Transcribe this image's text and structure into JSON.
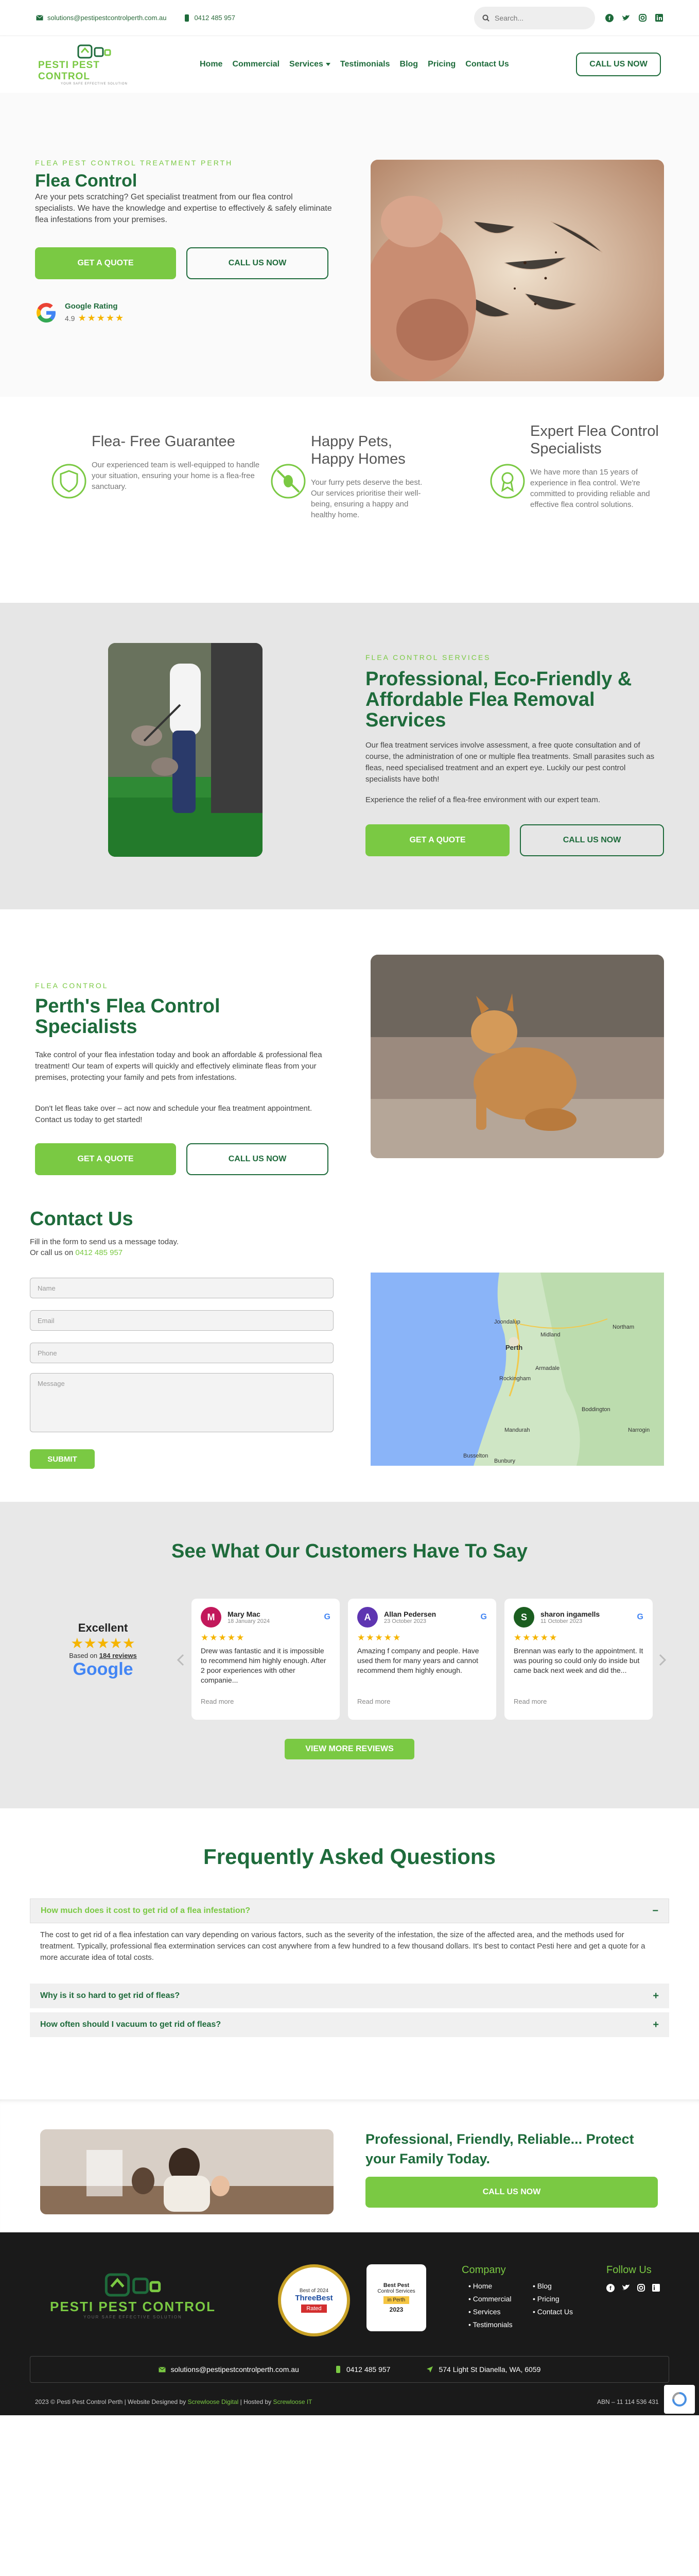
{
  "topbar": {
    "email": "solutions@pestipestcontrolperth.com.au",
    "phone": "0412 485 957",
    "search_placeholder": "Search..."
  },
  "header": {
    "logo_name": "PESTI PEST CONTROL",
    "logo_tag": "YOUR SAFE EFFECTIVE SOLUTION",
    "nav": [
      {
        "label": "Home"
      },
      {
        "label": "Commercial"
      },
      {
        "label": "Services"
      },
      {
        "label": "Testimonials"
      },
      {
        "label": "Blog"
      },
      {
        "label": "Pricing"
      },
      {
        "label": "Contact Us"
      }
    ],
    "cta": "CALL US NOW"
  },
  "hero": {
    "eyebrow": "FLEA PEST CONTROL TREATMENT PERTH",
    "title": "Flea Control",
    "text": "Are your pets scratching? Get specialist treatment from our flea control specialists.  We have the knowledge and expertise to effectively & safely eliminate flea infestations from your premises.",
    "btn_quote": "GET A QUOTE",
    "btn_call": "CALL US NOW",
    "rating_label": "Google Rating",
    "rating_value": "4.9",
    "rating_stars": "★★★★★"
  },
  "features": [
    {
      "title": "Flea- Free Guarantee",
      "text": "Our experienced team is well-equipped to handle your situation, ensuring your home is a flea-free sanctuary."
    },
    {
      "title": "Happy Pets, Happy Homes",
      "text": "Your furry pets deserve the best. Our services prioritise their well-being, ensuring a happy and healthy home."
    },
    {
      "title": "Expert Flea Control Specialists",
      "text": "We have more than 15 years of experience in flea control. We're committed to providing reliable and effective flea control solutions."
    }
  ],
  "services": {
    "eyebrow": "FLEA CONTROL SERVICES",
    "title": "Professional, Eco-Friendly & Affordable Flea Removal Services",
    "p1": "Our flea treatment services involve assessment, a free quote consultation and of course, the administration of one or multiple flea treatments. Small parasites such as fleas, need specialised treatment and an expert eye. Luckily our pest control specialists have both!",
    "p2": "Experience the relief of a flea-free environment with our expert team.",
    "btn_quote": "GET A QUOTE",
    "btn_call": "CALL US NOW"
  },
  "perth": {
    "eyebrow": "FLEA CONTROL",
    "title": "Perth's Flea Control Specialists",
    "p1": "Take control of your flea infestation today and book an affordable & professional flea treatment! Our team of experts will quickly and effectively eliminate fleas from your premises, protecting your family and pets from infestations.",
    "p2": "Don't let fleas take over – act now and schedule your flea treatment appointment. Contact us today to get started!",
    "btn_quote": "GET A QUOTE",
    "btn_call": "CALL US NOW"
  },
  "contact": {
    "title": "Contact Us",
    "sub": "Fill in the form to send us a message today.",
    "call_prefix": "Or call us on",
    "phone": "0412 485 957",
    "name_ph": "Name",
    "email_ph": "Email",
    "phone_ph": "Phone",
    "message_ph": "Message",
    "submit": "SUBMIT",
    "map_labels": [
      "Perth",
      "Mandurah",
      "Joondalup",
      "Rockingham",
      "Bunbury",
      "Busselton",
      "Armadale",
      "Midland",
      "Northam",
      "Boddington",
      "Narrogin"
    ]
  },
  "reviews": {
    "title": "See What Our Customers Have To Say",
    "summary_label": "Excellent",
    "summary_stars": "★★★★★",
    "based_prefix": "Based on",
    "based_count": "184 reviews",
    "google": "Google",
    "cards": [
      {
        "initial": "M",
        "name": "Mary Mac",
        "date": "18 January 2024",
        "stars": "★★★★★",
        "text": "Drew was fantastic and it is impossible to recommend him highly enough. After 2 poor experiences with other companie...",
        "more": "Read more"
      },
      {
        "initial": "A",
        "name": "Allan Pedersen",
        "date": "23 October 2023",
        "stars": "★★★★★",
        "text": "Amazing f company and people. Have used them for many years and cannot recommend them highly enough.",
        "more": "Read more"
      },
      {
        "initial": "S",
        "name": "sharon ingamells",
        "date": "11 October 2023",
        "stars": "★★★★★",
        "text": "Brennan was early to the appointment. It was pouring so could only do inside but came back next week and did the...",
        "more": "Read more"
      }
    ],
    "btn": "VIEW MORE REVIEWS"
  },
  "faq": {
    "title": "Frequently Asked Questions",
    "items": [
      {
        "q": "How much does it cost to get rid of a flea infestation?",
        "a": "The cost to get rid of a flea infestation can vary depending on various factors, such as the severity of the infestation, the size of the affected area, and the methods used for treatment. Typically, professional flea extermination services can cost anywhere from a few hundred to a few thousand dollars. It's best to contact Pesti here and get a quote for a more accurate idea of total costs."
      },
      {
        "q": "Why is it so hard to get rid of fleas?"
      },
      {
        "q": "How often should I vacuum to get rid of fleas?"
      }
    ]
  },
  "cta": {
    "title": "Professional, Friendly, Reliable... Protect your Family Today.",
    "btn": "CALL US NOW"
  },
  "footer": {
    "badge1_lines": [
      "Best of 2024",
      "ThreeBest",
      "Rated"
    ],
    "badge2_lines": [
      "Best Pest",
      "Control Services",
      "in Perth",
      "2023"
    ],
    "company_title": "Company",
    "col1": [
      "Home",
      "Commercial",
      "Services",
      "Testimonials"
    ],
    "col2": [
      "Blog",
      "Pricing",
      "Contact Us"
    ],
    "follow_title": "Follow Us",
    "email": "solutions@pestipestcontrolperth.com.au",
    "phone": "0412 485 957",
    "address": "574 Light St Dianella, WA, 6059",
    "copyright": "2023 © Pesti Pest Control Perth | Website Designed by",
    "designer": "Screwloose Digital",
    "hosted_prefix": "| Hosted by",
    "host": "Screwloose IT",
    "abn": "ABN – 11 114 536 431"
  },
  "colors": {
    "green_dark": "#1e6b3b",
    "green_light": "#7ac943",
    "grey_bg": "#e6e6e6",
    "footer_bg": "#1a1a1a"
  }
}
